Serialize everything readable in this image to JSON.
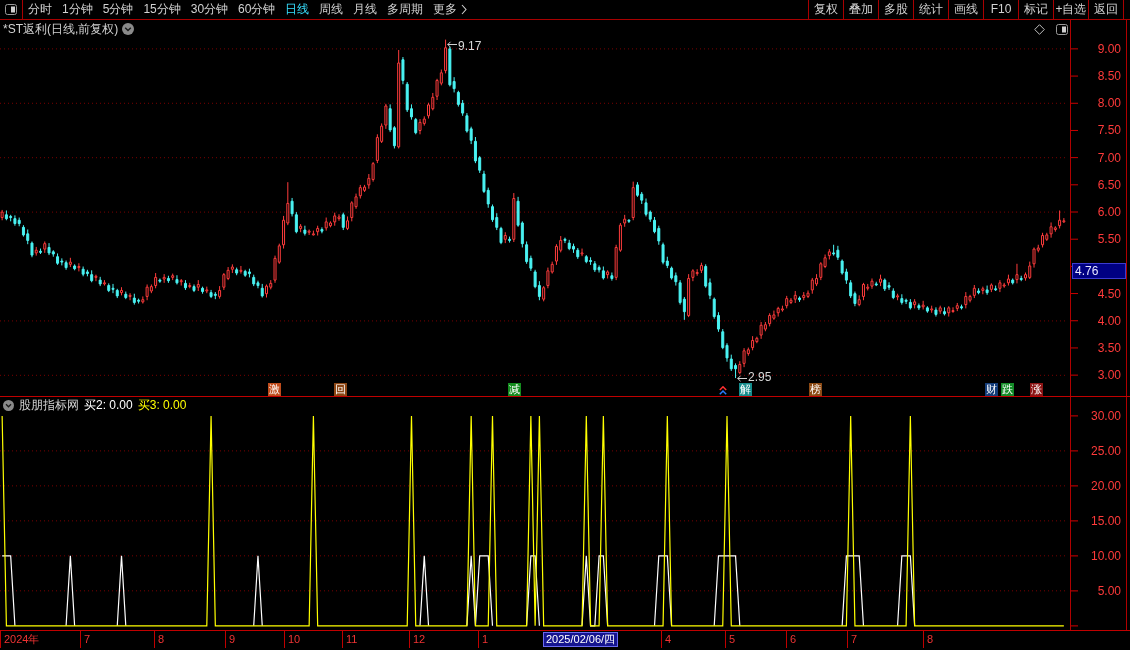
{
  "toolbar": {
    "period_tabs": [
      {
        "label": "分时",
        "kind": "period",
        "selected": false
      },
      {
        "label": "1分钟",
        "kind": "period",
        "selected": false
      },
      {
        "label": "5分钟",
        "kind": "period",
        "selected": false
      },
      {
        "label": "15分钟",
        "kind": "period",
        "selected": false
      },
      {
        "label": "30分钟",
        "kind": "period",
        "selected": false
      },
      {
        "label": "60分钟",
        "kind": "period",
        "selected": false
      },
      {
        "label": "日线",
        "kind": "period",
        "selected": true
      },
      {
        "label": "周线",
        "kind": "period",
        "selected": false
      },
      {
        "label": "月线",
        "kind": "period",
        "selected": false
      },
      {
        "label": "多周期",
        "kind": "period",
        "selected": false
      },
      {
        "label": "更多",
        "kind": "menu",
        "selected": false
      }
    ],
    "buttons": [
      "复权",
      "叠加",
      "多股",
      "统计",
      "画线",
      "F10",
      "标记",
      "+自选",
      "返回"
    ]
  },
  "chart_title": "*ST返利(日线,前复权)",
  "price_chart": {
    "high_label": "9.17",
    "low_label": "2.95",
    "cursor_price": "4.76",
    "markers": [
      {
        "text": "激",
        "color": "#c04c1c"
      },
      {
        "text": "回",
        "color": "#8c4614"
      },
      {
        "text": "减",
        "color": "#148c1e"
      },
      {
        "text": "解",
        "color": "#148c8c"
      },
      {
        "text": "榜",
        "color": "#8c4a14"
      },
      {
        "text": "财",
        "color": "#143c78"
      },
      {
        "text": "跌",
        "color": "#148c28"
      },
      {
        "text": "涨",
        "color": "#8c1414"
      }
    ],
    "chart_data": {
      "type": "candlestick",
      "grid": true,
      "ylim": [
        2.62,
        9.2
      ],
      "yticks": [
        {
          "value": 9,
          "label": "9.00"
        },
        {
          "value": 8.5,
          "label": "8.50"
        },
        {
          "value": 8,
          "label": "8.00"
        },
        {
          "value": 7.5,
          "label": "7.50"
        },
        {
          "value": 7,
          "label": "7.00"
        },
        {
          "value": 6.5,
          "label": "6.50"
        },
        {
          "value": 6,
          "label": "6.00"
        },
        {
          "value": 5.5,
          "label": "5.50"
        },
        {
          "value": 4.5,
          "label": "4.50"
        },
        {
          "value": 4,
          "label": "4.00"
        },
        {
          "value": 3.5,
          "label": "3.50"
        },
        {
          "value": 3,
          "label": "3.00"
        }
      ],
      "ohlc": [
        [
          5.9,
          6.04,
          5.85,
          6.0
        ],
        [
          5.95,
          6.03,
          5.85,
          5.88
        ],
        [
          5.92,
          5.95,
          5.83,
          5.9
        ],
        [
          5.88,
          5.94,
          5.75,
          5.79
        ],
        [
          5.85,
          5.9,
          5.74,
          5.79
        ],
        [
          5.72,
          5.76,
          5.55,
          5.58
        ],
        [
          5.6,
          5.68,
          5.41,
          5.48
        ],
        [
          5.43,
          5.46,
          5.17,
          5.21
        ],
        [
          5.25,
          5.36,
          5.2,
          5.3
        ],
        [
          5.28,
          5.33,
          5.23,
          5.26
        ],
        [
          5.32,
          5.46,
          5.25,
          5.42
        ],
        [
          5.35,
          5.43,
          5.21,
          5.25
        ],
        [
          5.27,
          5.3,
          5.18,
          5.23
        ],
        [
          5.18,
          5.24,
          5.03,
          5.06
        ],
        [
          5.1,
          5.15,
          5.02,
          5.09
        ],
        [
          5.07,
          5.11,
          4.94,
          4.98
        ],
        [
          5.04,
          5.16,
          4.99,
          5.08
        ],
        [
          5.01,
          5.04,
          4.93,
          4.96
        ],
        [
          4.98,
          5.06,
          4.91,
          5.0
        ],
        [
          4.95,
          5.0,
          4.82,
          4.86
        ],
        [
          4.9,
          4.94,
          4.82,
          4.87
        ],
        [
          4.85,
          4.93,
          4.71,
          4.74
        ],
        [
          4.8,
          4.85,
          4.73,
          4.82
        ],
        [
          4.75,
          4.81,
          4.64,
          4.68
        ],
        [
          4.7,
          4.75,
          4.65,
          4.7
        ],
        [
          4.65,
          4.69,
          4.53,
          4.56
        ],
        [
          4.6,
          4.68,
          4.51,
          4.58
        ],
        [
          4.56,
          4.59,
          4.42,
          4.46
        ],
        [
          4.52,
          4.62,
          4.47,
          4.56
        ],
        [
          4.49,
          4.54,
          4.4,
          4.43
        ],
        [
          4.45,
          4.51,
          4.38,
          4.47
        ],
        [
          4.42,
          4.5,
          4.3,
          4.34
        ],
        [
          4.38,
          4.41,
          4.32,
          4.37
        ],
        [
          4.35,
          4.45,
          4.32,
          4.39
        ],
        [
          4.45,
          4.67,
          4.38,
          4.62
        ],
        [
          4.55,
          4.67,
          4.51,
          4.63
        ],
        [
          4.65,
          4.88,
          4.6,
          4.8
        ],
        [
          4.75,
          4.78,
          4.7,
          4.73
        ],
        [
          4.77,
          4.86,
          4.7,
          4.8
        ],
        [
          4.78,
          4.83,
          4.7,
          4.74
        ],
        [
          4.8,
          4.87,
          4.75,
          4.83
        ],
        [
          4.76,
          4.84,
          4.67,
          4.7
        ],
        [
          4.72,
          4.77,
          4.65,
          4.74
        ],
        [
          4.69,
          4.75,
          4.57,
          4.61
        ],
        [
          4.65,
          4.7,
          4.6,
          4.65
        ],
        [
          4.63,
          4.67,
          4.53,
          4.56
        ],
        [
          4.62,
          4.75,
          4.55,
          4.67
        ],
        [
          4.6,
          4.63,
          4.5,
          4.54
        ],
        [
          4.56,
          4.63,
          4.51,
          4.57
        ],
        [
          4.52,
          4.57,
          4.42,
          4.45
        ],
        [
          4.49,
          4.53,
          4.4,
          4.47
        ],
        [
          4.45,
          4.64,
          4.41,
          4.56
        ],
        [
          4.62,
          4.88,
          4.57,
          4.85
        ],
        [
          4.78,
          4.99,
          4.75,
          4.93
        ],
        [
          4.95,
          5.04,
          4.88,
          4.99
        ],
        [
          4.94,
          4.98,
          4.84,
          4.88
        ],
        [
          4.92,
          5.01,
          4.87,
          4.93
        ],
        [
          4.91,
          4.94,
          4.81,
          4.84
        ],
        [
          4.9,
          4.96,
          4.8,
          4.87
        ],
        [
          4.8,
          4.85,
          4.64,
          4.68
        ],
        [
          4.7,
          4.74,
          4.6,
          4.65
        ],
        [
          4.6,
          4.68,
          4.43,
          4.46
        ],
        [
          4.5,
          4.67,
          4.43,
          4.64
        ],
        [
          4.62,
          4.75,
          4.58,
          4.69
        ],
        [
          4.75,
          5.2,
          4.7,
          5.15
        ],
        [
          5.08,
          5.42,
          5.05,
          5.38
        ],
        [
          5.4,
          5.93,
          5.33,
          5.85
        ],
        [
          5.8,
          6.55,
          5.76,
          6.16
        ],
        [
          6.2,
          6.26,
          5.92,
          5.97
        ],
        [
          5.95,
          6.0,
          5.61,
          5.64
        ],
        [
          5.7,
          5.78,
          5.63,
          5.74
        ],
        [
          5.67,
          5.75,
          5.57,
          5.61
        ],
        [
          5.63,
          5.68,
          5.58,
          5.65
        ],
        [
          5.6,
          5.66,
          5.57,
          5.6
        ],
        [
          5.64,
          5.75,
          5.57,
          5.7
        ],
        [
          5.68,
          5.72,
          5.61,
          5.65
        ],
        [
          5.71,
          5.9,
          5.66,
          5.82
        ],
        [
          5.75,
          5.83,
          5.72,
          5.8
        ],
        [
          5.82,
          5.99,
          5.75,
          5.93
        ],
        [
          5.88,
          5.96,
          5.84,
          5.91
        ],
        [
          5.95,
          5.99,
          5.67,
          5.72
        ],
        [
          5.7,
          5.92,
          5.67,
          5.84
        ],
        [
          5.9,
          6.2,
          5.83,
          6.17
        ],
        [
          6.1,
          6.34,
          6.06,
          6.28
        ],
        [
          6.3,
          6.5,
          6.25,
          6.45
        ],
        [
          6.4,
          6.5,
          6.37,
          6.46
        ],
        [
          6.5,
          6.7,
          6.43,
          6.62
        ],
        [
          6.6,
          6.92,
          6.56,
          6.89
        ],
        [
          6.95,
          7.43,
          6.9,
          7.37
        ],
        [
          7.3,
          7.63,
          7.27,
          7.58
        ],
        [
          7.6,
          7.99,
          7.53,
          7.95
        ],
        [
          7.9,
          7.98,
          7.47,
          7.51
        ],
        [
          7.55,
          7.58,
          7.17,
          7.22
        ],
        [
          7.2,
          8.98,
          7.17,
          8.74
        ],
        [
          8.8,
          8.85,
          8.35,
          8.42
        ],
        [
          8.35,
          8.39,
          7.84,
          7.88
        ],
        [
          7.9,
          7.98,
          7.7,
          7.75
        ],
        [
          7.7,
          7.73,
          7.43,
          7.46
        ],
        [
          7.5,
          7.71,
          7.43,
          7.65
        ],
        [
          7.63,
          7.76,
          7.59,
          7.71
        ],
        [
          7.77,
          8.01,
          7.72,
          7.97
        ],
        [
          7.9,
          8.19,
          7.87,
          8.11
        ],
        [
          8.13,
          8.45,
          8.06,
          8.42
        ],
        [
          8.37,
          8.62,
          8.33,
          8.56
        ],
        [
          8.6,
          9.17,
          8.55,
          9.02
        ],
        [
          9.0,
          9.04,
          8.31,
          8.34
        ],
        [
          8.4,
          8.48,
          8.2,
          8.27
        ],
        [
          8.2,
          8.23,
          7.94,
          7.98
        ],
        [
          8.0,
          8.06,
          7.77,
          7.82
        ],
        [
          7.77,
          7.82,
          7.46,
          7.49
        ],
        [
          7.53,
          7.57,
          7.25,
          7.32
        ],
        [
          7.3,
          7.38,
          6.9,
          6.94
        ],
        [
          7.0,
          7.03,
          6.72,
          6.77
        ],
        [
          6.7,
          6.76,
          6.35,
          6.38
        ],
        [
          6.4,
          6.45,
          6.08,
          6.15
        ],
        [
          6.1,
          6.14,
          5.82,
          5.86
        ],
        [
          5.9,
          5.98,
          5.67,
          5.72
        ],
        [
          5.7,
          5.73,
          5.41,
          5.44
        ],
        [
          5.5,
          5.63,
          5.43,
          5.57
        ],
        [
          5.5,
          5.55,
          5.44,
          5.48
        ],
        [
          5.5,
          6.35,
          5.45,
          6.25
        ],
        [
          6.2,
          6.28,
          5.73,
          5.76
        ],
        [
          5.8,
          5.83,
          5.35,
          5.42
        ],
        [
          5.4,
          5.46,
          5.05,
          5.09
        ],
        [
          5.15,
          5.2,
          4.92,
          4.97
        ],
        [
          4.9,
          4.94,
          4.6,
          4.63
        ],
        [
          4.65,
          4.73,
          4.38,
          4.45
        ],
        [
          4.4,
          4.64,
          4.36,
          4.61
        ],
        [
          4.65,
          4.98,
          4.6,
          4.92
        ],
        [
          4.9,
          5.09,
          4.87,
          5.04
        ],
        [
          5.1,
          5.41,
          5.03,
          5.37
        ],
        [
          5.3,
          5.56,
          5.26,
          5.48
        ],
        [
          5.5,
          5.53,
          5.43,
          5.48
        ],
        [
          5.43,
          5.49,
          5.3,
          5.33
        ],
        [
          5.37,
          5.42,
          5.25,
          5.32
        ],
        [
          5.3,
          5.34,
          5.14,
          5.18
        ],
        [
          5.24,
          5.33,
          5.19,
          5.25
        ],
        [
          5.18,
          5.21,
          5.06,
          5.09
        ],
        [
          5.11,
          5.17,
          5.03,
          5.1
        ],
        [
          5.05,
          5.1,
          4.9,
          4.94
        ],
        [
          4.98,
          5.02,
          4.89,
          4.94
        ],
        [
          4.92,
          5.0,
          4.76,
          4.79
        ],
        [
          4.85,
          4.93,
          4.78,
          4.9
        ],
        [
          4.83,
          4.89,
          4.74,
          4.78
        ],
        [
          4.8,
          5.4,
          4.75,
          5.35
        ],
        [
          5.3,
          5.8,
          5.27,
          5.76
        ],
        [
          5.8,
          5.95,
          5.73,
          5.87
        ],
        [
          5.85,
          5.87,
          5.8,
          5.84
        ],
        [
          5.9,
          6.56,
          5.85,
          6.45
        ],
        [
          6.5,
          6.55,
          6.28,
          6.31
        ],
        [
          6.33,
          6.37,
          6.15,
          6.22
        ],
        [
          6.17,
          6.25,
          5.92,
          5.96
        ],
        [
          6.0,
          6.03,
          5.82,
          5.87
        ],
        [
          5.85,
          5.91,
          5.61,
          5.64
        ],
        [
          5.7,
          5.75,
          5.4,
          5.47
        ],
        [
          5.4,
          5.44,
          5.04,
          5.08
        ],
        [
          5.1,
          5.18,
          4.97,
          5.02
        ],
        [
          4.97,
          5.0,
          4.76,
          4.79
        ],
        [
          4.83,
          4.89,
          4.65,
          4.72
        ],
        [
          4.7,
          4.75,
          4.3,
          4.34
        ],
        [
          4.4,
          4.44,
          4.02,
          4.17
        ],
        [
          4.1,
          4.86,
          4.07,
          4.78
        ],
        [
          4.8,
          4.95,
          4.73,
          4.92
        ],
        [
          4.87,
          4.95,
          4.83,
          4.89
        ],
        [
          4.93,
          5.07,
          4.88,
          5.02
        ],
        [
          5.0,
          5.04,
          4.61,
          4.64
        ],
        [
          4.7,
          4.78,
          4.4,
          4.47
        ],
        [
          4.4,
          4.43,
          4.04,
          4.08
        ],
        [
          4.1,
          4.16,
          3.8,
          3.85
        ],
        [
          3.8,
          3.85,
          3.48,
          3.51
        ],
        [
          3.55,
          3.59,
          3.25,
          3.32
        ],
        [
          3.3,
          3.38,
          3.08,
          3.12
        ],
        [
          3.18,
          3.22,
          2.95,
          3.12
        ],
        [
          3.05,
          3.26,
          3.02,
          3.2
        ],
        [
          3.22,
          3.5,
          3.15,
          3.45
        ],
        [
          3.4,
          3.51,
          3.36,
          3.47
        ],
        [
          3.51,
          3.72,
          3.46,
          3.64
        ],
        [
          3.62,
          3.71,
          3.59,
          3.68
        ],
        [
          3.74,
          3.98,
          3.67,
          3.92
        ],
        [
          3.85,
          3.98,
          3.81,
          3.93
        ],
        [
          3.95,
          4.14,
          3.9,
          4.1
        ],
        [
          4.05,
          4.19,
          4.02,
          4.11
        ],
        [
          4.15,
          4.26,
          4.08,
          4.23
        ],
        [
          4.21,
          4.28,
          4.17,
          4.22
        ],
        [
          4.28,
          4.46,
          4.23,
          4.41
        ],
        [
          4.34,
          4.42,
          4.31,
          4.38
        ],
        [
          4.4,
          4.55,
          4.33,
          4.47
        ],
        [
          4.42,
          4.45,
          4.35,
          4.39
        ],
        [
          4.43,
          4.53,
          4.38,
          4.47
        ],
        [
          4.45,
          4.56,
          4.42,
          4.51
        ],
        [
          4.57,
          4.79,
          4.5,
          4.75
        ],
        [
          4.68,
          4.86,
          4.64,
          4.78
        ],
        [
          4.8,
          5.08,
          4.75,
          5.05
        ],
        [
          5.0,
          5.22,
          4.97,
          5.16
        ],
        [
          5.2,
          5.32,
          5.13,
          5.27
        ],
        [
          5.25,
          5.4,
          5.2,
          5.24
        ],
        [
          5.3,
          5.38,
          5.12,
          5.17
        ],
        [
          5.1,
          5.13,
          4.85,
          4.88
        ],
        [
          4.9,
          4.96,
          4.68,
          4.75
        ],
        [
          4.7,
          4.75,
          4.42,
          4.46
        ],
        [
          4.5,
          4.54,
          4.27,
          4.32
        ],
        [
          4.3,
          4.47,
          4.27,
          4.39
        ],
        [
          4.45,
          4.7,
          4.38,
          4.67
        ],
        [
          4.6,
          4.68,
          4.56,
          4.62
        ],
        [
          4.64,
          4.78,
          4.59,
          4.73
        ],
        [
          4.68,
          4.72,
          4.64,
          4.67
        ],
        [
          4.71,
          4.85,
          4.64,
          4.77
        ],
        [
          4.75,
          4.78,
          4.55,
          4.59
        ],
        [
          4.65,
          4.71,
          4.57,
          4.62
        ],
        [
          4.55,
          4.6,
          4.4,
          4.43
        ],
        [
          4.45,
          4.5,
          4.38,
          4.46
        ],
        [
          4.41,
          4.49,
          4.3,
          4.34
        ],
        [
          4.38,
          4.41,
          4.31,
          4.36
        ],
        [
          4.34,
          4.4,
          4.21,
          4.24
        ],
        [
          4.3,
          4.4,
          4.23,
          4.35
        ],
        [
          4.28,
          4.32,
          4.2,
          4.24
        ],
        [
          4.26,
          4.37,
          4.21,
          4.29
        ],
        [
          4.24,
          4.27,
          4.15,
          4.18
        ],
        [
          4.22,
          4.28,
          4.15,
          4.22
        ],
        [
          4.2,
          4.25,
          4.08,
          4.12
        ],
        [
          4.18,
          4.28,
          4.13,
          4.24
        ],
        [
          4.17,
          4.25,
          4.1,
          4.13
        ],
        [
          4.15,
          4.27,
          4.08,
          4.24
        ],
        [
          4.19,
          4.25,
          4.15,
          4.19
        ],
        [
          4.23,
          4.33,
          4.18,
          4.28
        ],
        [
          4.26,
          4.3,
          4.21,
          4.24
        ],
        [
          4.3,
          4.53,
          4.23,
          4.45
        ],
        [
          4.38,
          4.48,
          4.34,
          4.45
        ],
        [
          4.47,
          4.66,
          4.42,
          4.6
        ],
        [
          4.55,
          4.6,
          4.49,
          4.52
        ],
        [
          4.56,
          4.63,
          4.49,
          4.59
        ],
        [
          4.57,
          4.65,
          4.48,
          4.52
        ],
        [
          4.58,
          4.69,
          4.53,
          4.66
        ],
        [
          4.59,
          4.65,
          4.55,
          4.58
        ],
        [
          4.6,
          4.75,
          4.53,
          4.7
        ],
        [
          4.65,
          4.7,
          4.61,
          4.66
        ],
        [
          4.7,
          4.85,
          4.65,
          4.77
        ],
        [
          4.75,
          4.78,
          4.67,
          4.7
        ],
        [
          4.76,
          5.05,
          4.69,
          4.85
        ],
        [
          4.78,
          4.83,
          4.73,
          4.77
        ],
        [
          4.79,
          4.89,
          4.74,
          4.85
        ],
        [
          4.8,
          5.09,
          4.77,
          5.01
        ],
        [
          5.05,
          5.35,
          4.98,
          5.32
        ],
        [
          5.3,
          5.4,
          5.26,
          5.34
        ],
        [
          5.4,
          5.62,
          5.35,
          5.57
        ],
        [
          5.5,
          5.62,
          5.47,
          5.58
        ],
        [
          5.6,
          5.81,
          5.53,
          5.73
        ],
        [
          5.68,
          5.74,
          5.64,
          5.71
        ],
        [
          5.75,
          6.03,
          5.7,
          5.85
        ],
        [
          5.83,
          5.89,
          5.8,
          5.84
        ]
      ]
    }
  },
  "indicator": {
    "name": "股朋指标网",
    "legend": [
      "买2: 0.00",
      "买3: 0.00"
    ],
    "chart_data": {
      "type": "line",
      "grid": true,
      "ylim": [
        -0.6,
        32.7
      ],
      "yticks": [
        {
          "value": 30,
          "label": "30.00"
        },
        {
          "value": 25,
          "label": "25.00"
        },
        {
          "value": 20,
          "label": "20.00"
        },
        {
          "value": 15,
          "label": "15.00"
        },
        {
          "value": 10,
          "label": "10.00"
        },
        {
          "value": 5,
          "label": "5.00"
        }
      ],
      "series": [
        {
          "color": "#ffffff",
          "values": [
            10,
            10,
            10,
            0,
            null,
            null,
            null,
            null,
            null,
            null,
            null,
            null,
            null,
            null,
            null,
            0,
            10,
            0,
            null,
            null,
            null,
            null,
            null,
            null,
            null,
            null,
            null,
            0,
            10,
            0,
            null,
            null,
            null,
            null,
            null,
            null,
            null,
            null,
            null,
            null,
            null,
            null,
            null,
            null,
            null,
            null,
            null,
            null,
            null,
            null,
            null,
            null,
            null,
            null,
            null,
            null,
            null,
            null,
            null,
            0,
            10,
            0,
            null,
            null,
            null,
            null,
            null,
            null,
            null,
            null,
            null,
            null,
            null,
            null,
            null,
            null,
            null,
            null,
            null,
            null,
            null,
            null,
            null,
            null,
            null,
            null,
            null,
            null,
            null,
            null,
            null,
            null,
            null,
            null,
            null,
            null,
            null,
            null,
            0,
            10,
            0,
            null,
            null,
            null,
            null,
            null,
            null,
            null,
            null,
            0,
            10,
            0,
            10,
            10,
            10,
            0,
            null,
            null,
            null,
            null,
            null,
            null,
            null,
            0,
            10,
            10,
            0,
            null,
            null,
            null,
            null,
            null,
            null,
            null,
            null,
            null,
            0,
            10,
            0,
            0,
            10,
            10,
            0,
            null,
            null,
            null,
            null,
            null,
            null,
            null,
            null,
            null,
            null,
            0,
            10,
            10,
            10,
            0,
            null,
            null,
            null,
            null,
            null,
            null,
            null,
            null,
            null,
            0,
            10,
            10,
            10,
            10,
            10,
            0,
            null,
            null,
            null,
            null,
            null,
            null,
            null,
            null,
            null,
            null,
            null,
            null,
            null,
            null,
            null,
            null,
            null,
            null,
            null,
            null,
            null,
            null,
            null,
            0,
            10,
            10,
            10,
            10,
            0,
            null,
            null,
            null,
            null,
            null,
            null,
            null,
            0,
            10,
            10,
            10,
            0,
            null,
            null,
            null,
            null,
            null,
            null,
            null,
            null,
            null,
            null,
            null,
            null,
            null,
            null,
            null,
            null,
            null,
            null,
            null,
            null,
            null,
            null,
            null,
            null,
            null,
            null,
            null,
            null,
            null,
            null,
            null,
            null,
            null,
            null,
            null
          ]
        },
        {
          "color": "#ffff00",
          "values": [
            30,
            0,
            0,
            0,
            0,
            0,
            0,
            0,
            0,
            0,
            0,
            0,
            0,
            0,
            0,
            0,
            0,
            0,
            0,
            0,
            0,
            0,
            0,
            0,
            0,
            0,
            0,
            0,
            0,
            0,
            0,
            0,
            0,
            0,
            0,
            0,
            0,
            0,
            0,
            0,
            0,
            0,
            0,
            0,
            0,
            0,
            0,
            0,
            0,
            30,
            0,
            0,
            0,
            0,
            0,
            0,
            0,
            0,
            0,
            0,
            0,
            0,
            0,
            0,
            0,
            0,
            0,
            0,
            0,
            0,
            0,
            0,
            0,
            30,
            0,
            0,
            0,
            0,
            0,
            0,
            0,
            0,
            0,
            0,
            0,
            0,
            0,
            0,
            0,
            0,
            0,
            0,
            0,
            0,
            0,
            0,
            30,
            0,
            0,
            0,
            0,
            0,
            0,
            0,
            0,
            0,
            0,
            0,
            0,
            0,
            30,
            0,
            0,
            0,
            0,
            30,
            0,
            0,
            0,
            0,
            0,
            0,
            0,
            0,
            30,
            0,
            30,
            0,
            0,
            0,
            0,
            0,
            0,
            0,
            0,
            0,
            0,
            30,
            0,
            0,
            0,
            30,
            0,
            0,
            0,
            0,
            0,
            0,
            0,
            0,
            0,
            0,
            0,
            0,
            0,
            0,
            30,
            0,
            0,
            0,
            0,
            0,
            0,
            0,
            0,
            0,
            0,
            0,
            0,
            0,
            30,
            0,
            0,
            0,
            0,
            0,
            0,
            0,
            0,
            0,
            0,
            0,
            0,
            0,
            0,
            0,
            0,
            0,
            0,
            0,
            0,
            0,
            0,
            0,
            0,
            0,
            0,
            0,
            0,
            30,
            0,
            0,
            0,
            0,
            0,
            0,
            0,
            0,
            0,
            0,
            0,
            0,
            0,
            30,
            0,
            0,
            0,
            0,
            0,
            0,
            0,
            0,
            0,
            0,
            0,
            0,
            0,
            0,
            0,
            0,
            0,
            0,
            0,
            0,
            0,
            0,
            0,
            0,
            0,
            0,
            0,
            0,
            0,
            0,
            0,
            0,
            0,
            0,
            0,
            0
          ]
        }
      ]
    }
  },
  "date_axis": {
    "labels": [
      "2024年",
      "7",
      "8",
      "9",
      "10",
      "11",
      "12",
      "1",
      "4",
      "5",
      "6",
      "7",
      "8"
    ],
    "cursor_date": "2025/02/06/四"
  }
}
